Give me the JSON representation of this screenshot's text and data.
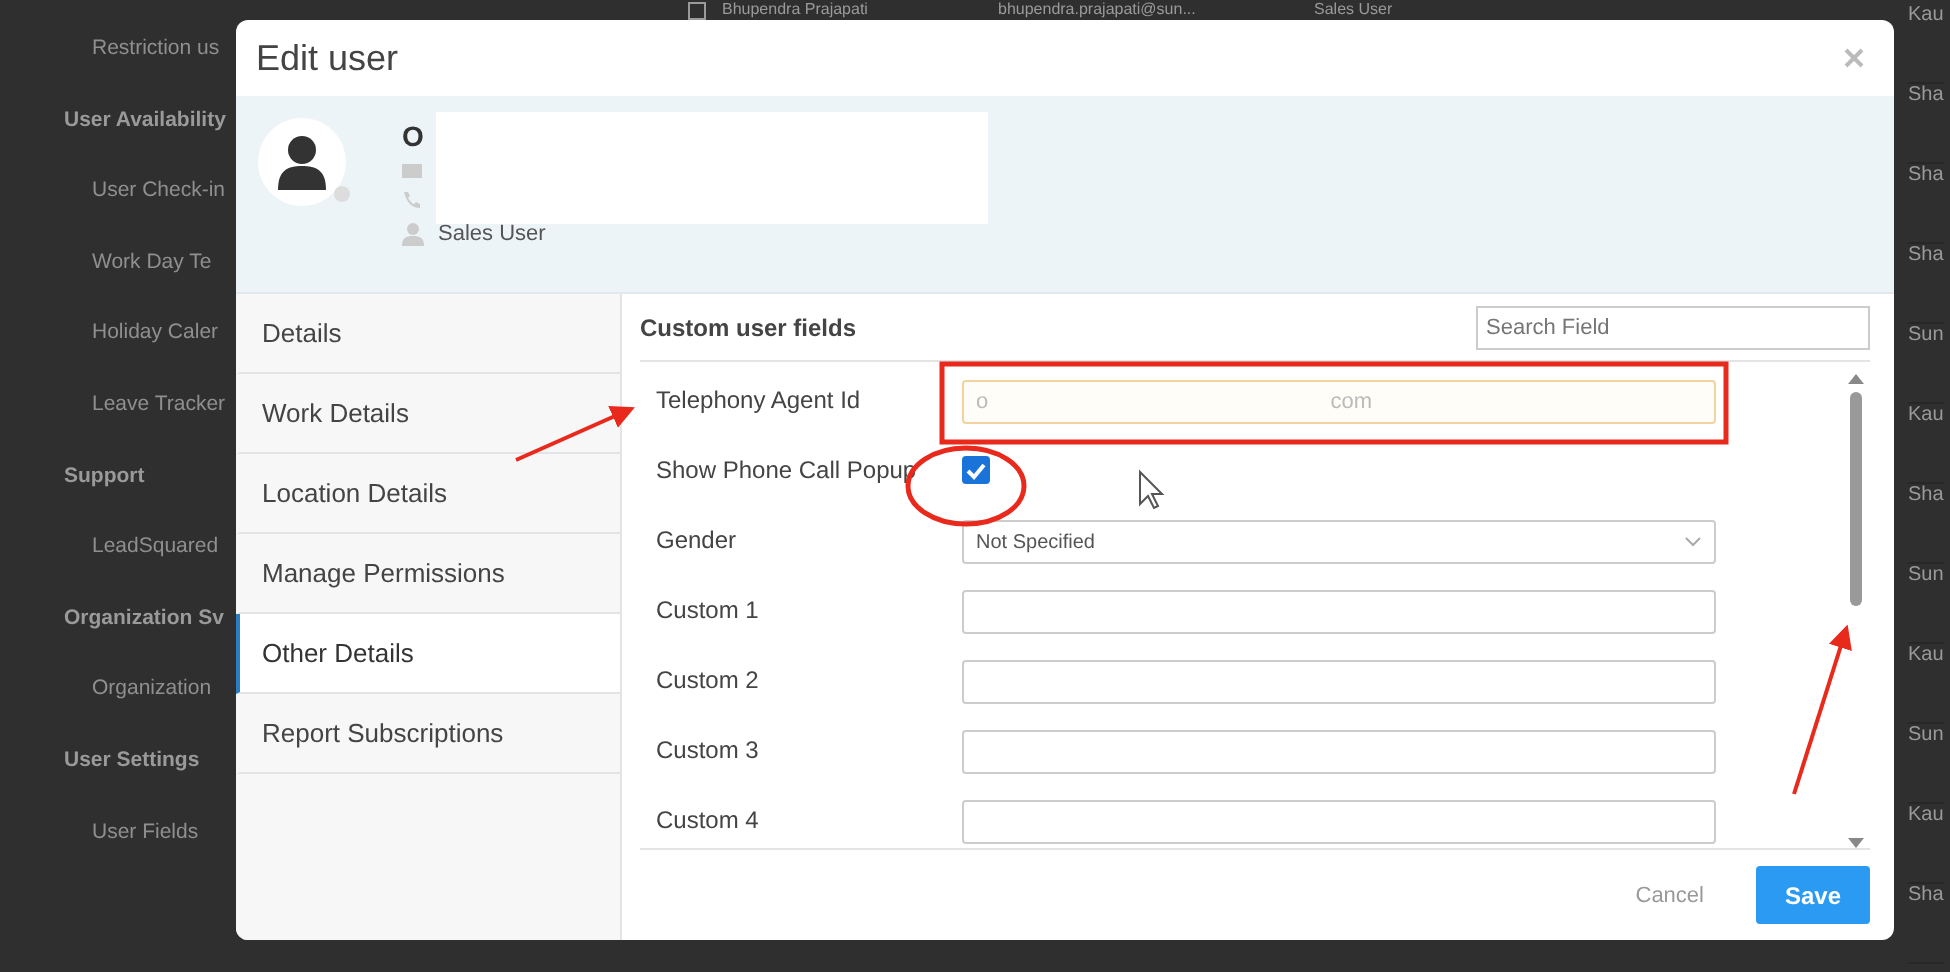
{
  "background": {
    "sidebar": [
      {
        "kind": "item",
        "label": "Restriction us"
      },
      {
        "kind": "heading",
        "label": "User Availability"
      },
      {
        "kind": "item",
        "label": "User Check-in"
      },
      {
        "kind": "item",
        "label": "Work Day Te"
      },
      {
        "kind": "item",
        "label": "Holiday Caler"
      },
      {
        "kind": "item",
        "label": "Leave Tracker"
      },
      {
        "kind": "heading",
        "label": "Support"
      },
      {
        "kind": "item",
        "label": "LeadSquared"
      },
      {
        "kind": "heading",
        "label": "Organization Sv"
      },
      {
        "kind": "item",
        "label": "Organization"
      },
      {
        "kind": "heading",
        "label": "User Settings"
      },
      {
        "kind": "item",
        "label": "User Fields"
      }
    ],
    "table_row": {
      "checked": false,
      "cells": [
        "Bhupendra Prajapati",
        "bhupendra.prajapati@sun...",
        "Sales User"
      ]
    },
    "right_column": [
      "Kau",
      "Sha",
      "Sha",
      "Sha",
      "Sun",
      "Kau",
      "Sha",
      "Sun",
      "Kau",
      "Sun",
      "Kau",
      "Sha"
    ]
  },
  "dialog": {
    "title": "Edit user",
    "profile": {
      "name": "O",
      "role": "Sales User"
    },
    "tabs": [
      {
        "label": "Details",
        "selected": false
      },
      {
        "label": "Work Details",
        "selected": false
      },
      {
        "label": "Location Details",
        "selected": false
      },
      {
        "label": "Manage Permissions",
        "selected": false
      },
      {
        "label": "Other Details",
        "selected": true
      },
      {
        "label": "Report Subscriptions",
        "selected": false
      }
    ],
    "panel": {
      "title": "Custom user fields",
      "search": {
        "placeholder": "Search Field"
      },
      "fields": [
        {
          "kind": "text",
          "label": "Telephony Agent Id",
          "value": "o                                                        com"
        },
        {
          "kind": "checkbox",
          "label": "Show Phone Call Popup",
          "checked": true
        },
        {
          "kind": "select",
          "label": "Gender",
          "value": "Not Specified"
        },
        {
          "kind": "text",
          "label": "Custom 1"
        },
        {
          "kind": "text",
          "label": "Custom 2"
        },
        {
          "kind": "text",
          "label": "Custom 3"
        },
        {
          "kind": "text",
          "label": "Custom 4"
        }
      ]
    },
    "buttons": [
      {
        "kind": "cancel",
        "label": "Cancel"
      },
      {
        "kind": "primary",
        "label": "Save"
      }
    ]
  }
}
